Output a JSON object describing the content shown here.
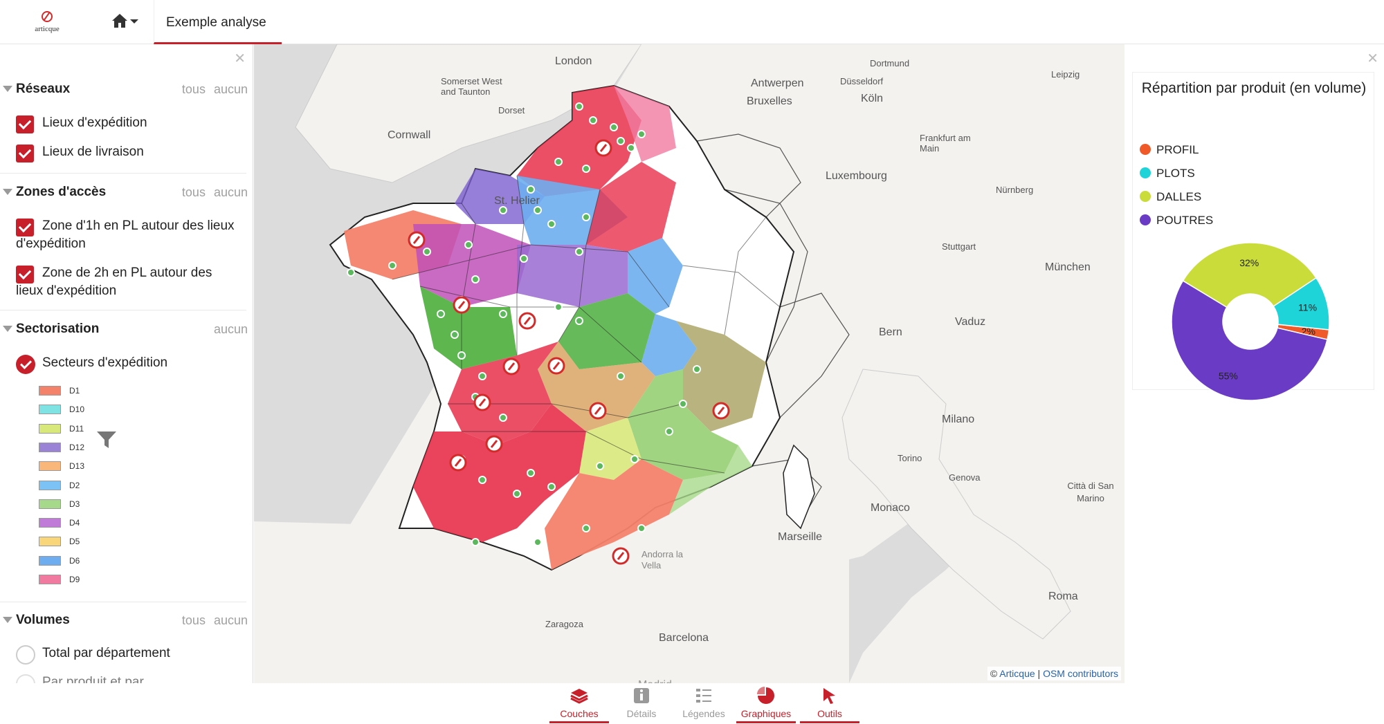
{
  "app": {
    "logo_text": "articque",
    "tab_title": "Exemple analyse"
  },
  "left_panel": {
    "sections": [
      {
        "title": "Réseaux",
        "links": [
          "tous",
          "aucun"
        ],
        "items": [
          {
            "label": "Lieux d'expédition",
            "checked": true
          },
          {
            "label": "Lieux de livraison",
            "checked": true
          }
        ]
      },
      {
        "title": "Zones d'accès",
        "links": [
          "tous",
          "aucun"
        ],
        "items": [
          {
            "label": "Zone d'1h en PL autour des lieux d'expédition",
            "checked": true
          },
          {
            "label": "Zone de 2h en PL autour des lieux d'expédition",
            "checked": true
          }
        ]
      },
      {
        "title": "Sectorisation",
        "links": [
          "aucun"
        ],
        "items": [
          {
            "label": "Secteurs d'expédition",
            "checked": true
          }
        ]
      },
      {
        "title": "Volumes",
        "links": [
          "tous",
          "aucun"
        ],
        "items": [
          {
            "label": "Total par département",
            "checked": false
          },
          {
            "label": "Par produit et par...",
            "checked": false
          }
        ]
      }
    ],
    "legend": [
      {
        "label": "D1",
        "color": "#f4826a"
      },
      {
        "label": "D10",
        "color": "#7fe3e3"
      },
      {
        "label": "D11",
        "color": "#d8e87a"
      },
      {
        "label": "D12",
        "color": "#9a82d6"
      },
      {
        "label": "D13",
        "color": "#f9b77a"
      },
      {
        "label": "D2",
        "color": "#7cc2f4"
      },
      {
        "label": "D3",
        "color": "#a7d98a"
      },
      {
        "label": "D4",
        "color": "#c07ad8"
      },
      {
        "label": "D5",
        "color": "#f8d679"
      },
      {
        "label": "D6",
        "color": "#6eaef0"
      },
      {
        "label": "D9",
        "color": "#f07aa0"
      }
    ]
  },
  "map": {
    "labels": [
      {
        "text": "London"
      },
      {
        "text": "Somerset West and Taunton"
      },
      {
        "text": "Dorset"
      },
      {
        "text": "Cornwall"
      },
      {
        "text": "Antwerpen"
      },
      {
        "text": "Bruxelles"
      },
      {
        "text": "Dortmund"
      },
      {
        "text": "Düsseldorf"
      },
      {
        "text": "Köln"
      },
      {
        "text": "Leipzig"
      },
      {
        "text": "Frankfurt am Main"
      },
      {
        "text": "Luxembourg"
      },
      {
        "text": "Nürnberg"
      },
      {
        "text": "St. Helier"
      },
      {
        "text": "Stuttgart"
      },
      {
        "text": "München"
      },
      {
        "text": "Vaduz"
      },
      {
        "text": "Bern"
      },
      {
        "text": "Milano"
      },
      {
        "text": "Torino"
      },
      {
        "text": "Genova"
      },
      {
        "text": "Città di San Marino"
      },
      {
        "text": "Monaco"
      },
      {
        "text": "Marseille"
      },
      {
        "text": "Andorra la Vella"
      },
      {
        "text": "Zaragoza"
      },
      {
        "text": "Barcelona"
      },
      {
        "text": "Roma"
      },
      {
        "text": "Madrid"
      }
    ],
    "attribution_prefix": "©",
    "attribution_links": [
      "Articque",
      "OSM contributors"
    ]
  },
  "right_panel": {
    "chart_title": "Répartition par produit (en volume)"
  },
  "chart_data": {
    "type": "pie",
    "title": "Répartition par produit (en volume)",
    "categories": [
      "PROFIL",
      "PLOTS",
      "DALLES",
      "POUTRES"
    ],
    "values": [
      2,
      11,
      32,
      55
    ],
    "colors": [
      "#ef5a28",
      "#1ed4d8",
      "#c9dc3a",
      "#6a3bc4"
    ],
    "value_labels": [
      "2%",
      "11%",
      "32%",
      "55%"
    ],
    "donut": true
  },
  "bottom_bar": {
    "items": [
      {
        "label": "Couches",
        "active": true
      },
      {
        "label": "Détails",
        "active": false
      },
      {
        "label": "Légendes",
        "active": false
      },
      {
        "label": "Graphiques",
        "active": true
      },
      {
        "label": "Outils",
        "active": true
      }
    ]
  }
}
